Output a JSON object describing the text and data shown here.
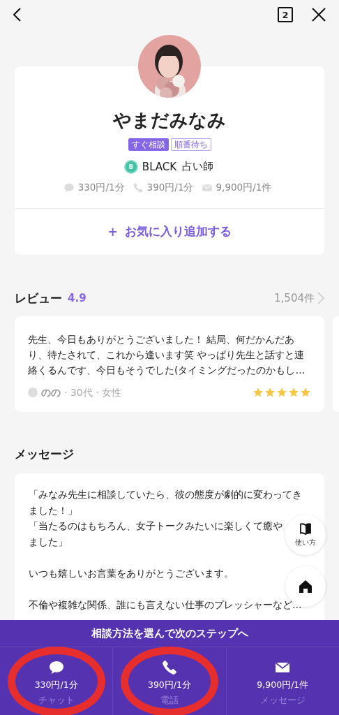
{
  "top_bar": {
    "tab_count": "2"
  },
  "profile": {
    "name": "やまだみなみ",
    "tags": [
      {
        "label": "すぐ相談",
        "kind": "filled"
      },
      {
        "label": "順番待ち",
        "kind": "outline"
      }
    ],
    "rank": {
      "badge": "B",
      "label": "BLACK",
      "role": "占い師"
    },
    "prices": [
      {
        "kind": "chat",
        "text": "330円/1分"
      },
      {
        "kind": "phone",
        "text": "390円/1分"
      },
      {
        "kind": "mail",
        "text": "9,900円/1件"
      }
    ],
    "favorite_button": {
      "icon": "+",
      "label": "お気に入り追加する"
    }
  },
  "reviews": {
    "title": "レビュー",
    "rating": "4.9",
    "count": "1,504件",
    "items": [
      {
        "text": "先生、今日もありがとうございました！ 結局、何だかんだあり、待たされて、これから逢います笑 やっぱり先生と話すと連絡くるんです、今日もそうでした(タイミングだったのかもし…",
        "author": "のの",
        "details": "· 30代 · 女性",
        "stars": 5
      }
    ]
  },
  "message": {
    "title": "メッセージ",
    "paragraphs": [
      {
        "lines": [
          "「みなみ先生に相談していたら、彼の態度が劇的に変わってき",
          "ました！」",
          "「当たるのはもちろん、女子トークみたいに楽しくて癒や",
          "ました」"
        ]
      },
      {
        "lines": [
          "いつも嬉しいお言葉をありがとうございます。"
        ]
      },
      {
        "lines": [
          "不倫や複雑な関係、誰にも言えない仕事のプレッシャーなど…"
        ]
      }
    ]
  },
  "floating_buttons": [
    {
      "kind": "guide",
      "label": "使い方"
    },
    {
      "kind": "home"
    }
  ],
  "bottom_bar": {
    "title": "相談方法を選んで次のステップへ",
    "options": [
      {
        "kind": "chat",
        "price": "330円/1分",
        "label": "チャット",
        "circled": true
      },
      {
        "kind": "phone",
        "price": "390円/1分",
        "label": "電話",
        "circled": true
      },
      {
        "kind": "mail",
        "price": "9,900円/1件",
        "label": "メッセージ",
        "circled": false
      }
    ]
  }
}
